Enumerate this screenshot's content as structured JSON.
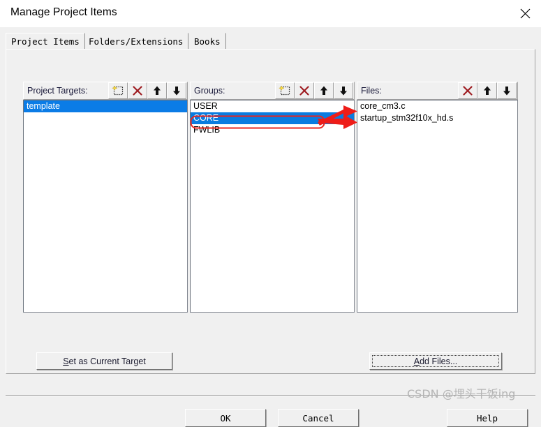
{
  "window": {
    "title": "Manage Project Items",
    "close_icon": "close-icon"
  },
  "tabs": [
    {
      "label": "Project Items",
      "selected": true
    },
    {
      "label": "Folders/Extensions",
      "selected": false
    },
    {
      "label": "Books",
      "selected": false
    }
  ],
  "panels": {
    "targets": {
      "label": "Project Targets:",
      "tools": [
        "new-item-icon",
        "delete-icon",
        "move-up-icon",
        "move-down-icon"
      ],
      "items": [
        {
          "label": "template",
          "selected": true
        }
      ]
    },
    "groups": {
      "label": "Groups:",
      "tools": [
        "new-item-icon",
        "delete-icon",
        "move-up-icon",
        "move-down-icon"
      ],
      "items": [
        {
          "label": "USER",
          "selected": false
        },
        {
          "label": "CORE",
          "selected": true
        },
        {
          "label": "FWLIB",
          "selected": false
        }
      ]
    },
    "files": {
      "label": "Files:",
      "tools": [
        "delete-icon",
        "move-up-icon",
        "move-down-icon"
      ],
      "items": [
        {
          "label": "core_cm3.c",
          "selected": false
        },
        {
          "label": "startup_stm32f10x_hd.s",
          "selected": false
        }
      ]
    }
  },
  "buttons": {
    "set_as_current_target": {
      "accel": "S",
      "rest": "et as Current Target"
    },
    "add_files": {
      "accel": "A",
      "rest": "dd Files..."
    },
    "ok": "OK",
    "cancel": "Cancel",
    "help": "Help"
  },
  "annotations": {
    "highlight_color": "#e8251f",
    "arrow_color": "#ee1c18",
    "highlighted_item": "CORE",
    "arrow_count": 2
  },
  "watermark": {
    "text": "CSDN @埋头干饭ing",
    "color": "#b4b4b4"
  },
  "colors": {
    "dialog_bg": "#f0f0f0",
    "titlebar_bg": "#ffffff",
    "selection_blue": "#0b7ce6",
    "border_gray": "#a0a0a0",
    "delete_red": "#9e1b20",
    "sparkle_yellow": "#ffe14d"
  }
}
